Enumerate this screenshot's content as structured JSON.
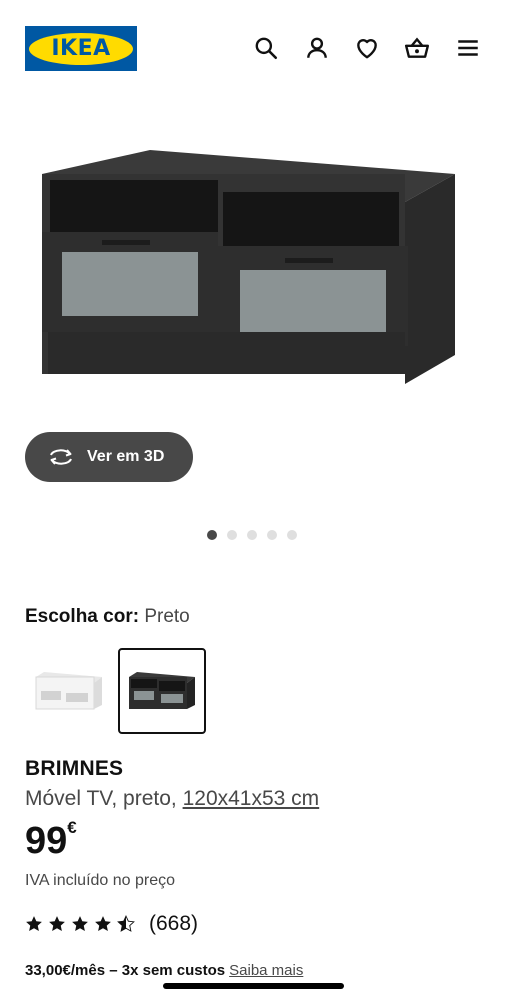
{
  "header": {
    "logo_text": "IKEA",
    "icons": [
      "search-icon",
      "user-icon",
      "heart-icon",
      "basket-icon",
      "menu-icon"
    ]
  },
  "gallery": {
    "view_3d_label": "Ver em 3D",
    "dots_count": 5,
    "active_dot": 1
  },
  "color": {
    "label": "Escolha cor:",
    "selected": "Preto",
    "options": [
      "white",
      "black"
    ]
  },
  "product": {
    "name": "BRIMNES",
    "description": "Móvel TV, preto,",
    "measurements": "120x41x53 cm",
    "price": "99",
    "currency": "€",
    "vat_note": "IVA incluído no preço",
    "rating_value": 4.5,
    "review_count": "(668)"
  },
  "financing": {
    "text": "33,00€/mês – 3x sem custos",
    "link": "Saiba mais"
  },
  "colors": {
    "ikea_blue": "#0058a3",
    "ikea_yellow": "#ffdb00",
    "button_dark": "#484848"
  }
}
